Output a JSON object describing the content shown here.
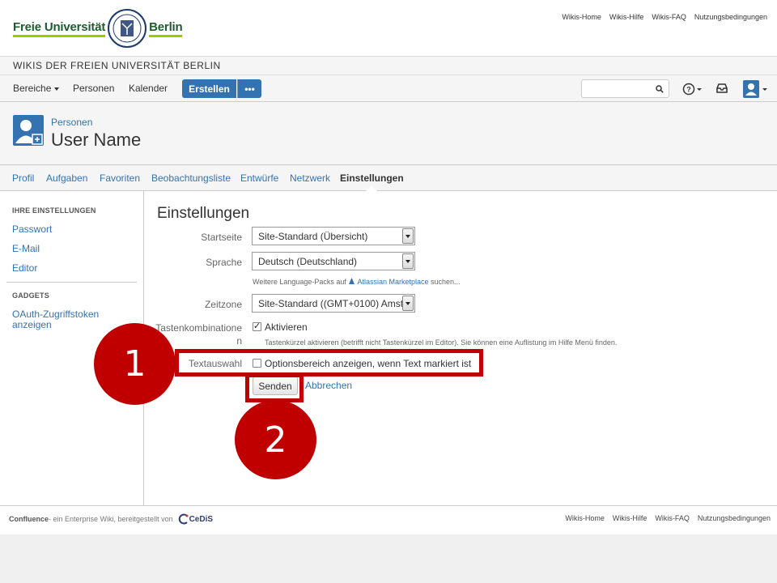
{
  "brand": {
    "logo_left": "Freie Universität",
    "logo_right": "Berlin",
    "top_links": [
      "Wikis-Home",
      "Wikis-Hilfe",
      "Wikis-FAQ",
      "Nutzungsbedingungen"
    ]
  },
  "site_title": "WIKIS DER FREIEN UNIVERSITÄT BERLIN",
  "nav": {
    "items": [
      "Bereiche",
      "Personen",
      "Kalender"
    ],
    "create_label": "Erstellen",
    "more_label": "•••",
    "search_placeholder": ""
  },
  "profile": {
    "parent": "Personen",
    "name": "User Name"
  },
  "tabs": [
    "Profil",
    "Aufgaben",
    "Favoriten",
    "Beobachtungsliste",
    "Entwürfe",
    "Netzwerk",
    "Einstellungen"
  ],
  "sidebar": {
    "heading_settings": "IHRE EINSTELLUNGEN",
    "settings_links": [
      "Passwort",
      "E-Mail",
      "Editor"
    ],
    "heading_gadgets": "GADGETS",
    "gadget_link_line1": "OAuth-Zugriffstoken",
    "gadget_link_line2": "anzeigen"
  },
  "form": {
    "title": "Einstellungen",
    "startseite_label": "Startseite",
    "startseite_value": "Site-Standard (Übersicht)",
    "sprache_label": "Sprache",
    "sprache_value": "Deutsch (Deutschland)",
    "language_help_prefix": "Weitere Language-Packs auf",
    "language_help_link": "Atlassian Marketplace",
    "language_help_suffix": "suchen...",
    "zeitzone_label": "Zeitzone",
    "zeitzone_value": "Site-Standard ((GMT+0100) Amste",
    "shortcuts_label_line1": "Tastenkombinatione",
    "shortcuts_label_line2": "n",
    "shortcuts_checkbox_label": "Aktivieren",
    "shortcuts_checked": true,
    "shortcuts_help": "Tastenkürzel aktivieren (betrifft nicht Tastenkürzel im Editor). Sie können eine Auflistung im Hilfe Menü finden.",
    "textauswahl_label": "Textauswahl",
    "textauswahl_checkbox_label": "Optionsbereich anzeigen, wenn Text markiert ist",
    "textauswahl_checked": false,
    "submit_label": "Senden",
    "cancel_label": "Abbrechen"
  },
  "annotations": {
    "badge1": "1",
    "badge2": "2",
    "color": "#c00000"
  },
  "footer": {
    "product": "Confluence",
    "tagline": " - ein Enterprise Wiki, bereitgestellt von",
    "provider": "CeDiS",
    "links": [
      "Wikis-Home",
      "Wikis-Hilfe",
      "Wikis-FAQ",
      "Nutzungsbedingungen"
    ]
  },
  "colors": {
    "accent": "#3572b0",
    "annotation": "#c00000",
    "brand_green": "#1d5c2e",
    "brand_lime": "#99cc00"
  }
}
